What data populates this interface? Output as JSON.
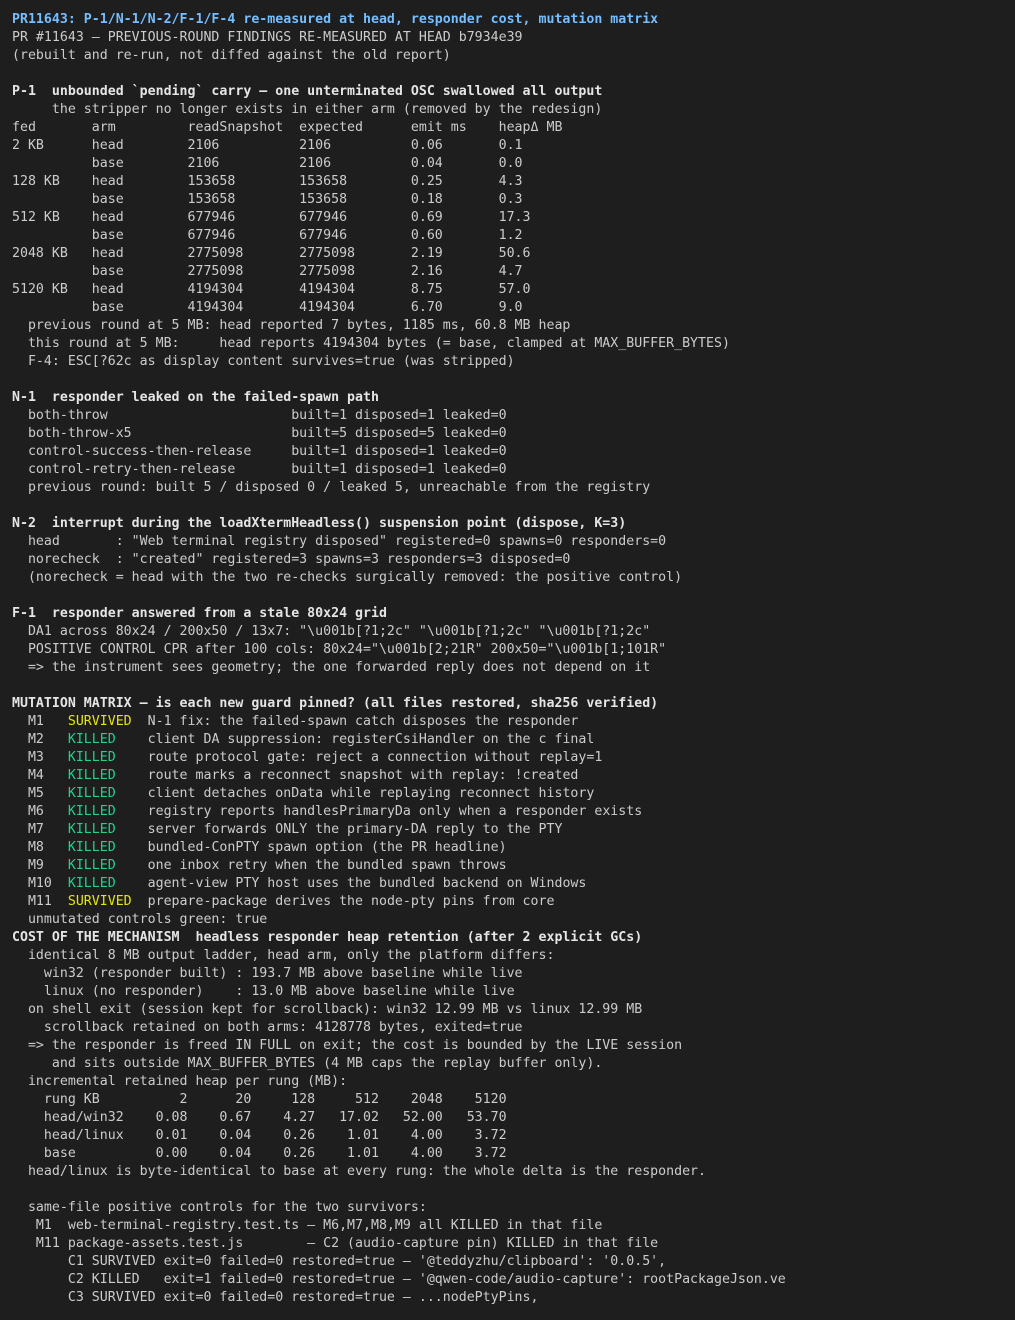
{
  "colors": {
    "background": "#1e1e1e",
    "text": "#cccccc",
    "title": "#75beff",
    "heading": "#e5e5e5",
    "survived": "#e5e510",
    "killed": "#23d18b"
  },
  "terminal": {
    "lines": [
      {
        "segments": [
          {
            "t": "PR11643: P-1/N-1/N-2/F-1/F-4 re-measured at head, responder cost, mutation matrix",
            "s": "title"
          }
        ]
      },
      {
        "segments": [
          {
            "t": "PR #11643 — PREVIOUS-ROUND FINDINGS RE-MEASURED AT HEAD b7934e39"
          }
        ]
      },
      {
        "segments": [
          {
            "t": "(rebuilt and re-run, not diffed against the old report)"
          }
        ]
      },
      {
        "segments": [
          {
            "t": ""
          }
        ]
      },
      {
        "segments": [
          {
            "t": "P-1  unbounded `pending` carry — one unterminated OSC swallowed all output",
            "s": "head"
          }
        ]
      },
      {
        "segments": [
          {
            "t": "     the stripper no longer exists in either arm (removed by the redesign)"
          }
        ]
      },
      {
        "segments": [
          {
            "t": "fed       arm         readSnapshot  expected      emit ms    heapΔ MB"
          }
        ]
      },
      {
        "segments": [
          {
            "t": "2 KB      head        2106          2106          0.06       0.1"
          }
        ]
      },
      {
        "segments": [
          {
            "t": "          base        2106          2106          0.04       0.0"
          }
        ]
      },
      {
        "segments": [
          {
            "t": "128 KB    head        153658        153658        0.25       4.3"
          }
        ]
      },
      {
        "segments": [
          {
            "t": "          base        153658        153658        0.18       0.3"
          }
        ]
      },
      {
        "segments": [
          {
            "t": "512 KB    head        677946        677946        0.69       17.3"
          }
        ]
      },
      {
        "segments": [
          {
            "t": "          base        677946        677946        0.60       1.2"
          }
        ]
      },
      {
        "segments": [
          {
            "t": "2048 KB   head        2775098       2775098       2.19       50.6"
          }
        ]
      },
      {
        "segments": [
          {
            "t": "          base        2775098       2775098       2.16       4.7"
          }
        ]
      },
      {
        "segments": [
          {
            "t": "5120 KB   head        4194304       4194304       8.75       57.0"
          }
        ]
      },
      {
        "segments": [
          {
            "t": "          base        4194304       4194304       6.70       9.0"
          }
        ]
      },
      {
        "segments": [
          {
            "t": "  previous round at 5 MB: head reported 7 bytes, 1185 ms, 60.8 MB heap"
          }
        ]
      },
      {
        "segments": [
          {
            "t": "  this round at 5 MB:     head reports 4194304 bytes (= base, clamped at MAX_BUFFER_BYTES)"
          }
        ]
      },
      {
        "segments": [
          {
            "t": "  F-4: ESC[?62c as display content survives=true (was stripped)"
          }
        ]
      },
      {
        "segments": [
          {
            "t": ""
          }
        ]
      },
      {
        "segments": [
          {
            "t": "N-1  responder leaked on the failed-spawn path",
            "s": "head"
          }
        ]
      },
      {
        "segments": [
          {
            "t": "  both-throw                       built=1 disposed=1 leaked=0"
          }
        ]
      },
      {
        "segments": [
          {
            "t": "  both-throw-x5                    built=5 disposed=5 leaked=0"
          }
        ]
      },
      {
        "segments": [
          {
            "t": "  control-success-then-release     built=1 disposed=1 leaked=0"
          }
        ]
      },
      {
        "segments": [
          {
            "t": "  control-retry-then-release       built=1 disposed=1 leaked=0"
          }
        ]
      },
      {
        "segments": [
          {
            "t": "  previous round: built 5 / disposed 0 / leaked 5, unreachable from the registry"
          }
        ]
      },
      {
        "segments": [
          {
            "t": ""
          }
        ]
      },
      {
        "segments": [
          {
            "t": "N-2  interrupt during the loadXtermHeadless() suspension point (dispose, K=3)",
            "s": "head"
          }
        ]
      },
      {
        "segments": [
          {
            "t": "  head       : \"Web terminal registry disposed\" registered=0 spawns=0 responders=0"
          }
        ]
      },
      {
        "segments": [
          {
            "t": "  norecheck  : \"created\" registered=3 spawns=3 responders=3 disposed=0"
          }
        ]
      },
      {
        "segments": [
          {
            "t": "  (norecheck = head with the two re-checks surgically removed: the positive control)"
          }
        ]
      },
      {
        "segments": [
          {
            "t": ""
          }
        ]
      },
      {
        "segments": [
          {
            "t": "F-1  responder answered from a stale 80x24 grid",
            "s": "head"
          }
        ]
      },
      {
        "segments": [
          {
            "t": "  DA1 across 80x24 / 200x50 / 13x7: \"\\u001b[?1;2c\" \"\\u001b[?1;2c\" \"\\u001b[?1;2c\""
          }
        ]
      },
      {
        "segments": [
          {
            "t": "  POSITIVE CONTROL CPR after 100 cols: 80x24=\"\\u001b[2;21R\" 200x50=\"\\u001b[1;101R\""
          }
        ]
      },
      {
        "segments": [
          {
            "t": "  => the instrument sees geometry; the one forwarded reply does not depend on it"
          }
        ]
      },
      {
        "segments": [
          {
            "t": ""
          }
        ]
      },
      {
        "segments": [
          {
            "t": "MUTATION MATRIX — is each new guard pinned? (all files restored, sha256 verified)",
            "s": "head"
          }
        ]
      },
      {
        "segments": [
          {
            "t": "  M1   "
          },
          {
            "t": "SURVIVED",
            "s": "surv"
          },
          {
            "t": "  N-1 fix: the failed-spawn catch disposes the responder"
          }
        ]
      },
      {
        "segments": [
          {
            "t": "  M2   "
          },
          {
            "t": "KILLED  ",
            "s": "kill"
          },
          {
            "t": "  client DA suppression: registerCsiHandler on the c final"
          }
        ]
      },
      {
        "segments": [
          {
            "t": "  M3   "
          },
          {
            "t": "KILLED  ",
            "s": "kill"
          },
          {
            "t": "  route protocol gate: reject a connection without replay=1"
          }
        ]
      },
      {
        "segments": [
          {
            "t": "  M4   "
          },
          {
            "t": "KILLED  ",
            "s": "kill"
          },
          {
            "t": "  route marks a reconnect snapshot with replay: !created"
          }
        ]
      },
      {
        "segments": [
          {
            "t": "  M5   "
          },
          {
            "t": "KILLED  ",
            "s": "kill"
          },
          {
            "t": "  client detaches onData while replaying reconnect history"
          }
        ]
      },
      {
        "segments": [
          {
            "t": "  M6   "
          },
          {
            "t": "KILLED  ",
            "s": "kill"
          },
          {
            "t": "  registry reports handlesPrimaryDa only when a responder exists"
          }
        ]
      },
      {
        "segments": [
          {
            "t": "  M7   "
          },
          {
            "t": "KILLED  ",
            "s": "kill"
          },
          {
            "t": "  server forwards ONLY the primary-DA reply to the PTY"
          }
        ]
      },
      {
        "segments": [
          {
            "t": "  M8   "
          },
          {
            "t": "KILLED  ",
            "s": "kill"
          },
          {
            "t": "  bundled-ConPTY spawn option (the PR headline)"
          }
        ]
      },
      {
        "segments": [
          {
            "t": "  M9   "
          },
          {
            "t": "KILLED  ",
            "s": "kill"
          },
          {
            "t": "  one inbox retry when the bundled spawn throws"
          }
        ]
      },
      {
        "segments": [
          {
            "t": "  M10  "
          },
          {
            "t": "KILLED  ",
            "s": "kill"
          },
          {
            "t": "  agent-view PTY host uses the bundled backend on Windows"
          }
        ]
      },
      {
        "segments": [
          {
            "t": "  M11  "
          },
          {
            "t": "SURVIVED",
            "s": "surv"
          },
          {
            "t": "  prepare-package derives the node-pty pins from core"
          }
        ]
      },
      {
        "segments": [
          {
            "t": "  unmutated controls green: true"
          }
        ]
      },
      {
        "segments": [
          {
            "t": "COST OF THE MECHANISM  headless responder heap retention (after 2 explicit GCs)",
            "s": "head"
          }
        ]
      },
      {
        "segments": [
          {
            "t": "  identical 8 MB output ladder, head arm, only the platform differs:"
          }
        ]
      },
      {
        "segments": [
          {
            "t": "    win32 (responder built) : 193.7 MB above baseline while live"
          }
        ]
      },
      {
        "segments": [
          {
            "t": "    linux (no responder)    : 13.0 MB above baseline while live"
          }
        ]
      },
      {
        "segments": [
          {
            "t": "  on shell exit (session kept for scrollback): win32 12.99 MB vs linux 12.99 MB"
          }
        ]
      },
      {
        "segments": [
          {
            "t": "    scrollback retained on both arms: 4128778 bytes, exited=true"
          }
        ]
      },
      {
        "segments": [
          {
            "t": "  => the responder is freed IN FULL on exit; the cost is bounded by the LIVE session"
          }
        ]
      },
      {
        "segments": [
          {
            "t": "     and sits outside MAX_BUFFER_BYTES (4 MB caps the replay buffer only)."
          }
        ]
      },
      {
        "segments": [
          {
            "t": "  incremental retained heap per rung (MB):"
          }
        ]
      },
      {
        "segments": [
          {
            "t": "    rung KB          2      20     128     512    2048    5120"
          }
        ]
      },
      {
        "segments": [
          {
            "t": "    head/win32    0.08    0.67    4.27   17.02   52.00   53.70"
          }
        ]
      },
      {
        "segments": [
          {
            "t": "    head/linux    0.01    0.04    0.26    1.01    4.00    3.72"
          }
        ]
      },
      {
        "segments": [
          {
            "t": "    base          0.00    0.04    0.26    1.01    4.00    3.72"
          }
        ]
      },
      {
        "segments": [
          {
            "t": "  head/linux is byte-identical to base at every rung: the whole delta is the responder."
          }
        ]
      },
      {
        "segments": [
          {
            "t": ""
          }
        ]
      },
      {
        "segments": [
          {
            "t": "  same-file positive controls for the two survivors:"
          }
        ]
      },
      {
        "segments": [
          {
            "t": "   M1  web-terminal-registry.test.ts — M6,M7,M8,M9 all KILLED in that file"
          }
        ]
      },
      {
        "segments": [
          {
            "t": "   M11 package-assets.test.js        — C2 (audio-capture pin) KILLED in that file"
          }
        ]
      },
      {
        "segments": [
          {
            "t": "       C1 SURVIVED exit=0 failed=0 restored=true — '@teddyzhu/clipboard': '0.0.5',"
          }
        ]
      },
      {
        "segments": [
          {
            "t": "       C2 KILLED   exit=1 failed=0 restored=true — '@qwen-code/audio-capture': rootPackageJson.ve"
          }
        ]
      },
      {
        "segments": [
          {
            "t": "       C3 SURVIVED exit=0 failed=0 restored=true — ...nodePtyPins,"
          }
        ]
      }
    ]
  }
}
